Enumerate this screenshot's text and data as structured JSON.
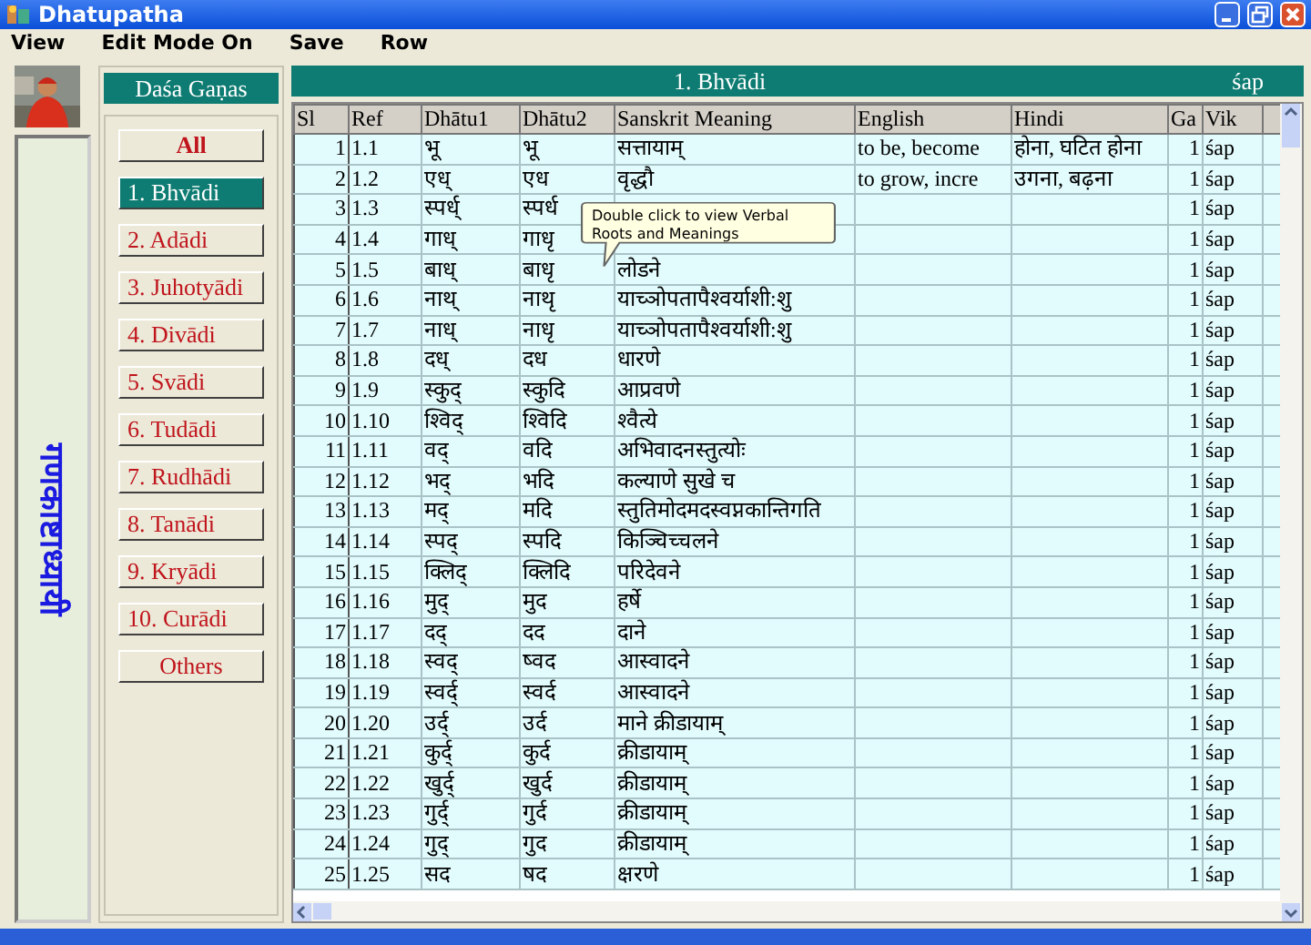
{
  "window": {
    "title": "Dhatupatha"
  },
  "menu": [
    "View",
    "Edit Mode On",
    "Save",
    "Row"
  ],
  "side_title": "गणकाष्टाध्यायी",
  "ganas": {
    "title": "Daśa Gaṇas",
    "buttons": [
      {
        "label": "All",
        "kind": "all",
        "selected": false
      },
      {
        "label": "1. Bhvādi",
        "kind": "gana",
        "selected": true
      },
      {
        "label": "2. Adādi",
        "kind": "gana",
        "selected": false
      },
      {
        "label": "3. Juhotyādi",
        "kind": "gana",
        "selected": false
      },
      {
        "label": "4. Divādi",
        "kind": "gana",
        "selected": false
      },
      {
        "label": "5. Svādi",
        "kind": "gana",
        "selected": false
      },
      {
        "label": "6. Tudādi",
        "kind": "gana",
        "selected": false
      },
      {
        "label": "7. Rudhādi",
        "kind": "gana",
        "selected": false
      },
      {
        "label": "8. Tanādi",
        "kind": "gana",
        "selected": false
      },
      {
        "label": "9. Kryādi",
        "kind": "gana",
        "selected": false
      },
      {
        "label": "10. Curādi",
        "kind": "gana",
        "selected": false
      },
      {
        "label": "Others",
        "kind": "others",
        "selected": false
      }
    ]
  },
  "gana_header": {
    "title": "1. Bhvādi",
    "vikarana": "śap"
  },
  "table": {
    "columns": [
      {
        "label": "Sl",
        "kind": "number"
      },
      {
        "label": "Ref",
        "kind": "text"
      },
      {
        "label": "Dhātu1",
        "kind": "text"
      },
      {
        "label": "Dhātu2",
        "kind": "text"
      },
      {
        "label": "Sanskrit Meaning",
        "kind": "text"
      },
      {
        "label": "English",
        "kind": "text"
      },
      {
        "label": "Hindi",
        "kind": "text"
      },
      {
        "label": "Ga",
        "kind": "number"
      },
      {
        "label": "Vik",
        "kind": "text"
      }
    ],
    "rows": [
      {
        "cells": [
          "1",
          "1.1",
          "भू",
          "भू",
          "सत्तायाम्",
          "to be, become",
          "होना, घटित होना",
          "1",
          "śap"
        ]
      },
      {
        "cells": [
          "2",
          "1.2",
          "एध्",
          "एध",
          "वृद्धौ",
          "to grow, incre",
          "उगना, बढ़ना",
          "1",
          "śap"
        ]
      },
      {
        "cells": [
          "3",
          "1.3",
          "स्पर्ध्",
          "स्पर्ध",
          null,
          null,
          null,
          "1",
          "śap"
        ]
      },
      {
        "cells": [
          "4",
          "1.4",
          "गाध्",
          "गाधृ",
          null,
          null,
          null,
          "1",
          "śap"
        ]
      },
      {
        "cells": [
          "5",
          "1.5",
          "बाध्",
          "बाधृ",
          "लोडने",
          null,
          null,
          "1",
          "śap"
        ]
      },
      {
        "cells": [
          "6",
          "1.6",
          "नाथ्",
          "नाथृ",
          "याच्ञोपतापैश्वर्याशी:शु",
          null,
          null,
          "1",
          "śap"
        ]
      },
      {
        "cells": [
          "7",
          "1.7",
          "नाध्",
          "नाधृ",
          "याच्ञोपतापैश्वर्याशी:शु",
          null,
          null,
          "1",
          "śap"
        ]
      },
      {
        "cells": [
          "8",
          "1.8",
          "दध्",
          "दध",
          "धारणे",
          null,
          null,
          "1",
          "śap"
        ]
      },
      {
        "cells": [
          "9",
          "1.9",
          "स्कुद्",
          "स्कुदि",
          "आप्रवणे",
          null,
          null,
          "1",
          "śap"
        ]
      },
      {
        "cells": [
          "10",
          "1.10",
          "श्विद्",
          "श्विदि",
          "श्वैत्ये",
          null,
          null,
          "1",
          "śap"
        ]
      },
      {
        "cells": [
          "11",
          "1.11",
          "वद्",
          "वदि",
          "अभिवादनस्तुत्योः",
          null,
          null,
          "1",
          "śap"
        ]
      },
      {
        "cells": [
          "12",
          "1.12",
          "भद्",
          "भदि",
          "कल्याणे सुखे च",
          null,
          null,
          "1",
          "śap"
        ]
      },
      {
        "cells": [
          "13",
          "1.13",
          "मद्",
          "मदि",
          "स्तुतिमोदमदस्वप्नकान्तिगति",
          null,
          null,
          "1",
          "śap"
        ]
      },
      {
        "cells": [
          "14",
          "1.14",
          "स्पद्",
          "स्पदि",
          "किञ्चिच्चलने",
          null,
          null,
          "1",
          "śap"
        ]
      },
      {
        "cells": [
          "15",
          "1.15",
          "क्लिद्",
          "क्लिदि",
          "परिदेवने",
          null,
          null,
          "1",
          "śap"
        ]
      },
      {
        "cells": [
          "16",
          "1.16",
          "मुद्",
          "मुद",
          "हर्षे",
          null,
          null,
          "1",
          "śap"
        ]
      },
      {
        "cells": [
          "17",
          "1.17",
          "दद्",
          "दद",
          "दाने",
          null,
          null,
          "1",
          "śap"
        ]
      },
      {
        "cells": [
          "18",
          "1.18",
          "स्वद्",
          "ष्वद",
          "आस्वादने",
          null,
          null,
          "1",
          "śap"
        ]
      },
      {
        "cells": [
          "19",
          "1.19",
          "स्वर्द्",
          "स्वर्द",
          "आस्वादने",
          null,
          null,
          "1",
          "śap"
        ]
      },
      {
        "cells": [
          "20",
          "1.20",
          "उर्द्",
          "उर्द",
          "माने क्रीडायाम्",
          null,
          null,
          "1",
          "śap"
        ]
      },
      {
        "cells": [
          "21",
          "1.21",
          "कुर्द्",
          "कुर्द",
          "क्रीडायाम्",
          null,
          null,
          "1",
          "śap"
        ]
      },
      {
        "cells": [
          "22",
          "1.22",
          "खुर्द्",
          "खुर्द",
          "क्रीडायाम्",
          null,
          null,
          "1",
          "śap"
        ]
      },
      {
        "cells": [
          "23",
          "1.23",
          "गुर्द्",
          "गुर्द",
          "क्रीडायाम्",
          null,
          null,
          "1",
          "śap"
        ]
      },
      {
        "cells": [
          "24",
          "1.24",
          "गुद्",
          "गुद",
          "क्रीडायाम्",
          null,
          null,
          "1",
          "śap"
        ]
      },
      {
        "cells": [
          "25",
          "1.25",
          "सद",
          "षद",
          "क्षरणे",
          null,
          null,
          "1",
          "śap"
        ]
      }
    ]
  },
  "tooltip": {
    "text": "Double click to view Verbal Roots and Meanings"
  }
}
